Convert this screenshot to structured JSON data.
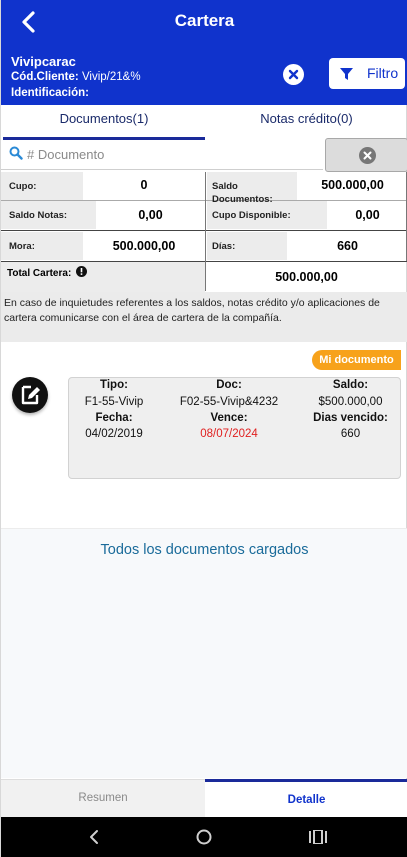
{
  "header": {
    "title": "Cartera",
    "client_name": "Vivipcarac",
    "client_code_label": "Cód.Cliente:",
    "client_code_value": "Vivip/21&%",
    "identification_label": "Identificación:",
    "identification_value": "",
    "filter_label": "Filtro"
  },
  "tabs": [
    {
      "label": "Documentos(1)",
      "active": true
    },
    {
      "label": "Notas crédito(0)",
      "active": false
    }
  ],
  "search": {
    "placeholder": "# Documento",
    "value": ""
  },
  "summary": {
    "cupo_label": "Cupo:",
    "cupo_value": "0",
    "saldo_docs_label": "Saldo Documentos:",
    "saldo_docs_value": "500.000,00",
    "saldo_notas_label": "Saldo Notas:",
    "saldo_notas_value": "0,00",
    "cupo_disp_label": "Cupo Disponible:",
    "cupo_disp_value": "0,00",
    "mora_label": "Mora:",
    "mora_value": "500.000,00",
    "dias_label": "Días:",
    "dias_value": "660",
    "total_label": "Total Cartera:",
    "total_value": "500.000,00"
  },
  "notice": "En caso de inquietudes referentes a los saldos, notas crédito y/o aplicaciones de cartera comunicarse con el área de cartera de la compañía.",
  "document": {
    "badge": "Mi documento",
    "tipo_label": "Tipo:",
    "tipo": "F1-55-Vivip",
    "doc_label": "Doc:",
    "doc": "F02-55-Vivip&4232",
    "saldo_label": "Saldo:",
    "saldo": "$500.000,00",
    "fecha_label": "Fecha:",
    "fecha": "04/02/2019",
    "vence_label": "Vence:",
    "vence": "08/07/2024",
    "dias_label": "Dias vencido:",
    "dias": "660"
  },
  "load_all_text": "Todos los documentos cargados",
  "bottom_tabs": [
    {
      "label": "Resumen",
      "active": false
    },
    {
      "label": "Detalle",
      "active": true
    }
  ],
  "colors": {
    "brand": "#1033cc",
    "accent_badge": "#f7a21b",
    "overdue": "#e02020"
  }
}
